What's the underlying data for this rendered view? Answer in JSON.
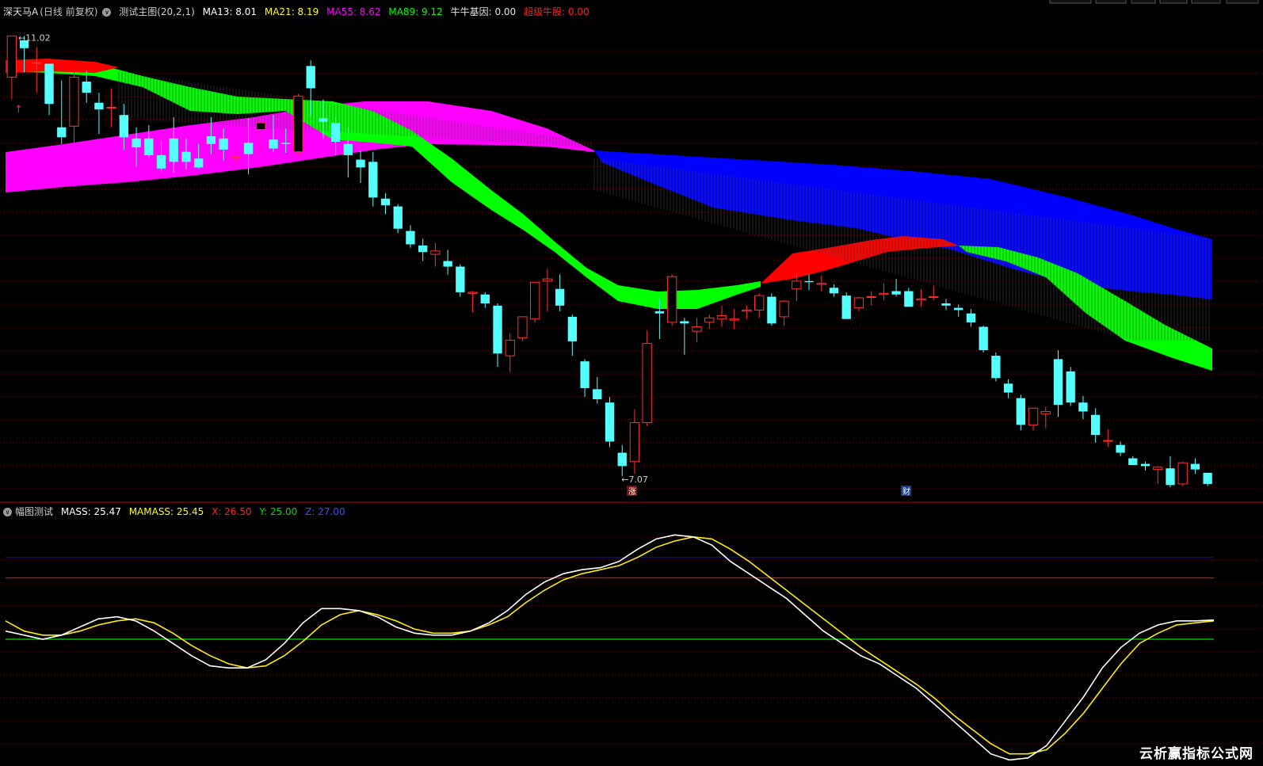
{
  "main_header": {
    "stock_name": "深天马A",
    "period": "(日线 前复权)",
    "indicator_name": "测试主图(20,2,1)",
    "ma13": "MA13: 8.01",
    "ma21": "MA21: 8.19",
    "ma55": "MA55: 8.62",
    "ma89": "MA89: 9.12",
    "niu_gene": "牛牛基因: 0.00",
    "super_bull": "超级牛股: 0.00"
  },
  "sub_header": {
    "indicator_name": "幅图测试",
    "mass": "MASS: 25.47",
    "mamass": "MAMASS: 25.45",
    "x": "X: 26.50",
    "y": "Y: 25.00",
    "z": "Z: 27.00"
  },
  "colors": {
    "up": "#ff3030",
    "down": "#54ffff",
    "band_green": "#00ff00",
    "band_magenta": "#ff00ff",
    "band_blue": "#0000ff",
    "band_red": "#ff0000",
    "mass_line": "#ffffff",
    "mamass_line": "#ffee00",
    "x_line": "#ff0000",
    "y_line": "#00dd00",
    "z_line": "#0000ff",
    "grid": "#800000"
  },
  "markers": {
    "high_label": "11.02",
    "low_label": "7.07",
    "event_zhang": "涨",
    "event_cai": "财"
  },
  "watermark": "云析赢指标公式网",
  "chart_data": [
    {
      "type": "candlestick",
      "title": "深天马A",
      "price_range": [
        6.9,
        11.2
      ],
      "high": 11.02,
      "low": 7.07,
      "candles": [
        [
          10.65,
          11.02,
          10.45,
          11.02
        ],
        [
          10.98,
          11.02,
          10.69,
          10.91
        ],
        [
          10.78,
          10.92,
          10.51,
          10.78
        ],
        [
          10.77,
          10.77,
          10.31,
          10.41
        ],
        [
          10.2,
          10.62,
          10.05,
          10.11
        ],
        [
          10.21,
          10.7,
          10.05,
          10.65
        ],
        [
          10.61,
          10.71,
          10.42,
          10.51
        ],
        [
          10.42,
          10.51,
          10.14,
          10.36
        ],
        [
          10.38,
          10.55,
          10.2,
          10.38
        ],
        [
          10.31,
          10.41,
          10.0,
          10.11
        ],
        [
          10.1,
          10.2,
          9.85,
          10.02
        ],
        [
          10.1,
          10.22,
          9.93,
          9.95
        ],
        [
          9.95,
          10.08,
          9.8,
          9.83
        ],
        [
          10.1,
          10.29,
          9.79,
          9.89
        ],
        [
          9.98,
          10.1,
          9.82,
          9.89
        ],
        [
          9.92,
          10.05,
          9.83,
          9.84
        ],
        [
          10.12,
          10.29,
          9.96,
          10.05
        ],
        [
          10.1,
          10.19,
          9.9,
          10.0
        ],
        [
          9.93,
          10.0,
          9.84,
          9.93
        ],
        [
          10.06,
          10.28,
          9.78,
          9.96
        ],
        [
          10.18,
          10.3,
          9.95,
          10.24
        ],
        [
          10.09,
          10.31,
          9.98,
          10.01
        ],
        [
          10.06,
          10.19,
          9.97,
          10.05
        ],
        [
          9.98,
          10.5,
          9.95,
          10.48
        ],
        [
          10.75,
          10.8,
          10.3,
          10.55
        ],
        [
          10.28,
          10.45,
          10.1,
          10.25
        ],
        [
          10.24,
          10.29,
          9.95,
          10.07
        ],
        [
          10.05,
          10.2,
          9.75,
          9.95
        ],
        [
          9.91,
          9.99,
          9.7,
          9.84
        ],
        [
          9.89,
          9.98,
          9.49,
          9.57
        ],
        [
          9.56,
          9.61,
          9.42,
          9.5
        ],
        [
          9.49,
          9.51,
          9.25,
          9.29
        ],
        [
          9.27,
          9.32,
          9.12,
          9.15
        ],
        [
          9.14,
          9.2,
          9.0,
          9.08
        ],
        [
          9.06,
          9.16,
          8.95,
          9.09
        ],
        [
          9.0,
          9.1,
          8.88,
          8.95
        ],
        [
          8.95,
          8.97,
          8.68,
          8.72
        ],
        [
          8.71,
          8.73,
          8.54,
          8.72
        ],
        [
          8.7,
          8.72,
          8.58,
          8.62
        ],
        [
          8.6,
          8.62,
          8.05,
          8.17
        ],
        [
          8.15,
          8.35,
          8.0,
          8.29
        ],
        [
          8.31,
          8.5,
          8.28,
          8.5
        ],
        [
          8.48,
          8.8,
          8.45,
          8.81
        ],
        [
          8.82,
          8.93,
          8.55,
          8.84
        ],
        [
          8.75,
          8.88,
          8.55,
          8.6
        ],
        [
          8.5,
          8.52,
          8.15,
          8.28
        ],
        [
          8.1,
          8.12,
          7.78,
          7.86
        ],
        [
          7.85,
          7.96,
          7.72,
          7.76
        ],
        [
          7.73,
          7.78,
          7.33,
          7.38
        ],
        [
          7.28,
          7.35,
          7.07,
          7.16
        ],
        [
          7.2,
          7.67,
          7.09,
          7.55
        ],
        [
          7.55,
          8.38,
          7.52,
          8.26
        ],
        [
          8.55,
          8.66,
          8.3,
          8.53
        ],
        [
          8.45,
          8.88,
          8.42,
          8.86
        ],
        [
          8.46,
          8.49,
          8.16,
          8.44
        ],
        [
          8.37,
          8.49,
          8.27,
          8.41
        ],
        [
          8.45,
          8.52,
          8.39,
          8.49
        ],
        [
          8.48,
          8.6,
          8.41,
          8.51
        ],
        [
          8.47,
          8.57,
          8.39,
          8.48
        ],
        [
          8.55,
          8.6,
          8.48,
          8.56
        ],
        [
          8.56,
          8.71,
          8.49,
          8.69
        ],
        [
          8.68,
          8.71,
          8.42,
          8.44
        ],
        [
          8.5,
          8.65,
          8.42,
          8.64
        ],
        [
          8.75,
          8.9,
          8.64,
          8.82
        ],
        [
          8.82,
          8.88,
          8.74,
          8.81
        ],
        [
          8.79,
          8.87,
          8.73,
          8.8
        ],
        [
          8.76,
          8.79,
          8.68,
          8.71
        ],
        [
          8.69,
          8.72,
          8.48,
          8.48
        ],
        [
          8.58,
          8.68,
          8.55,
          8.67
        ],
        [
          8.68,
          8.73,
          8.6,
          8.68
        ],
        [
          8.7,
          8.8,
          8.65,
          8.71
        ],
        [
          8.73,
          8.84,
          8.68,
          8.7
        ],
        [
          8.73,
          8.76,
          8.59,
          8.59
        ],
        [
          8.65,
          8.75,
          8.59,
          8.66
        ],
        [
          8.68,
          8.78,
          8.65,
          8.68
        ],
        [
          8.62,
          8.66,
          8.56,
          8.6
        ],
        [
          8.58,
          8.61,
          8.5,
          8.56
        ],
        [
          8.53,
          8.57,
          8.41,
          8.45
        ],
        [
          8.41,
          8.42,
          8.18,
          8.2
        ],
        [
          8.15,
          8.18,
          7.92,
          7.95
        ],
        [
          7.9,
          7.94,
          7.77,
          7.82
        ],
        [
          7.77,
          7.8,
          7.48,
          7.53
        ],
        [
          7.53,
          7.68,
          7.48,
          7.68
        ],
        [
          7.63,
          7.69,
          7.5,
          7.65
        ],
        [
          8.12,
          8.2,
          7.6,
          7.71
        ],
        [
          8.01,
          8.05,
          7.7,
          7.73
        ],
        [
          7.73,
          7.79,
          7.58,
          7.65
        ],
        [
          7.62,
          7.68,
          7.37,
          7.44
        ],
        [
          7.39,
          7.49,
          7.33,
          7.39
        ],
        [
          7.35,
          7.38,
          7.25,
          7.28
        ],
        [
          7.23,
          7.25,
          7.17,
          7.17
        ],
        [
          7.18,
          7.2,
          7.12,
          7.16
        ],
        [
          7.13,
          7.16,
          7.0,
          7.15
        ],
        [
          7.14,
          7.25,
          6.97,
          6.99
        ],
        [
          7.0,
          7.2,
          6.98,
          7.19
        ],
        [
          7.18,
          7.23,
          7.09,
          7.13
        ],
        [
          7.1,
          7.1,
          6.98,
          7.0
        ]
      ]
    },
    {
      "type": "line",
      "title": "幅图测试",
      "ylim": [
        22,
        28
      ],
      "series": [
        {
          "name": "MASS",
          "values": [
            25.2,
            25.1,
            25.0,
            25.1,
            25.3,
            25.5,
            25.55,
            25.45,
            25.2,
            24.9,
            24.6,
            24.35,
            24.3,
            24.3,
            24.5,
            24.9,
            25.4,
            25.75,
            25.75,
            25.7,
            25.55,
            25.3,
            25.15,
            25.1,
            25.1,
            25.2,
            25.4,
            25.7,
            26.1,
            26.4,
            26.6,
            26.7,
            26.75,
            26.9,
            27.2,
            27.45,
            27.55,
            27.5,
            27.3,
            26.9,
            26.6,
            26.3,
            26.0,
            25.6,
            25.2,
            24.9,
            24.6,
            24.4,
            24.1,
            23.8,
            23.4,
            23.0,
            22.6,
            22.2,
            22.05,
            22.1,
            22.4,
            23.0,
            23.6,
            24.3,
            24.8,
            25.15,
            25.35,
            25.45,
            25.45,
            25.47
          ]
        },
        {
          "name": "MAMASS",
          "values": [
            25.45,
            25.2,
            25.1,
            25.1,
            25.2,
            25.35,
            25.45,
            25.5,
            25.4,
            25.15,
            24.85,
            24.6,
            24.4,
            24.3,
            24.35,
            24.6,
            24.95,
            25.35,
            25.6,
            25.7,
            25.6,
            25.45,
            25.25,
            25.15,
            25.15,
            25.2,
            25.35,
            25.55,
            25.9,
            26.2,
            26.45,
            26.6,
            26.7,
            26.8,
            27.0,
            27.25,
            27.4,
            27.5,
            27.45,
            27.2,
            26.9,
            26.55,
            26.2,
            25.85,
            25.5,
            25.15,
            24.8,
            24.5,
            24.2,
            23.9,
            23.55,
            23.15,
            22.8,
            22.45,
            22.2,
            22.2,
            22.3,
            22.7,
            23.2,
            23.8,
            24.4,
            24.9,
            25.15,
            25.35,
            25.4,
            25.45
          ]
        },
        {
          "name": "X",
          "values": [
            26.5,
            26.5
          ]
        },
        {
          "name": "Y",
          "values": [
            25.0,
            25.0
          ]
        },
        {
          "name": "Z",
          "values": [
            27.0,
            27.0
          ]
        }
      ]
    }
  ]
}
